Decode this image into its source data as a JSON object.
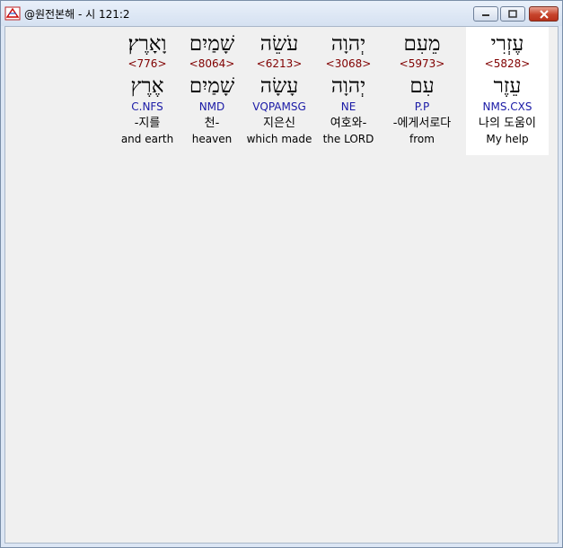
{
  "window": {
    "title": "@원전본해 - 시 121:2",
    "buttons": {
      "minimize": "–",
      "maximize": "□",
      "close": "✕"
    }
  },
  "columns": [
    {
      "hebrew": "עֶזְרִי",
      "strong": "<5828>",
      "lemma": "עֵזֶר",
      "morph": "NMS.CXS",
      "korean": "나의 도움이",
      "english": "My help",
      "selected": true
    },
    {
      "hebrew": "מֵעִם",
      "strong": "<5973>",
      "lemma": "עִם",
      "morph": "P.P",
      "korean": "-에게서로다",
      "english": "from",
      "selected": false
    },
    {
      "hebrew": "יְהוָה",
      "strong": "<3068>",
      "lemma": "יְהוָה",
      "morph": "NE",
      "korean": "여호와-",
      "english": "the LORD",
      "selected": false
    },
    {
      "hebrew": "עֹשֵׂה",
      "strong": "<6213>",
      "lemma": "עָשָׂה",
      "morph": "VQPAMSG",
      "korean": "지은신",
      "english": "which made",
      "selected": false
    },
    {
      "hebrew": "שָׁמַיִם",
      "strong": "<8064>",
      "lemma": "שָׁמַיִם",
      "morph": "NMD",
      "korean": "천-",
      "english": "heaven",
      "selected": false
    },
    {
      "hebrew": "וָאָרֶץ׃",
      "strong": "<776>",
      "lemma": "אֶרֶץ",
      "morph": "C.NFS",
      "korean": "-지를",
      "english": "and earth",
      "selected": false
    }
  ]
}
